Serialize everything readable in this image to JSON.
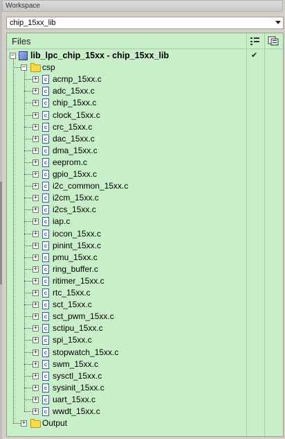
{
  "window": {
    "title": "Workspace"
  },
  "target_select": {
    "value": "chip_15xx_lib"
  },
  "files_panel": {
    "header": "Files"
  },
  "project": {
    "name": "lib_lpc_chip_15xx - chip_15xx_lib",
    "checked_mark": "✔"
  },
  "groups": [
    {
      "name": "csp",
      "files": [
        "acmp_15xx.c",
        "adc_15xx.c",
        "chip_15xx.c",
        "clock_15xx.c",
        "crc_15xx.c",
        "dac_15xx.c",
        "dma_15xx.c",
        "eeprom.c",
        "gpio_15xx.c",
        "i2c_common_15xx.c",
        "i2cm_15xx.c",
        "i2cs_15xx.c",
        "iap.c",
        "iocon_15xx.c",
        "pinint_15xx.c",
        "pmu_15xx.c",
        "ring_buffer.c",
        "ritimer_15xx.c",
        "rtc_15xx.c",
        "sct_15xx.c",
        "sct_pwm_15xx.c",
        "sctipu_15xx.c",
        "spi_15xx.c",
        "stopwatch_15xx.c",
        "swm_15xx.c",
        "sysctl_15xx.c",
        "sysinit_15xx.c",
        "uart_15xx.c",
        "wwdt_15xx.c"
      ]
    },
    {
      "name": "Output",
      "files": []
    }
  ],
  "icons": {
    "file": "c-source-file-icon",
    "folder": "folder-icon",
    "project": "project-icon"
  }
}
